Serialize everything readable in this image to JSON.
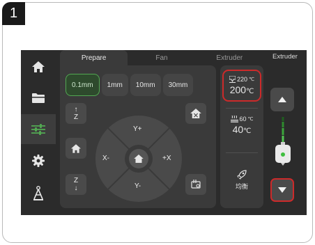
{
  "step_number": "1",
  "tabs": [
    {
      "label": "Prepare",
      "active": true
    },
    {
      "label": "Fan",
      "active": false
    },
    {
      "label": "Extruder",
      "active": false
    }
  ],
  "sidebar": {
    "items": [
      {
        "icon": "home-icon",
        "active": false
      },
      {
        "icon": "folder-icon",
        "active": false
      },
      {
        "icon": "sliders-icon",
        "active": true
      },
      {
        "icon": "gear-icon",
        "active": false
      },
      {
        "icon": "printer-tower-icon",
        "active": false
      }
    ]
  },
  "move": {
    "step_sizes": [
      "0.1mm",
      "1mm",
      "10mm",
      "30mm"
    ],
    "selected_step": "0.1mm",
    "z_up": "Z",
    "z_down": "Z",
    "y_plus": "Y+",
    "y_minus": "Y-",
    "x_minus": "X-",
    "x_plus": "+X"
  },
  "temperatures": {
    "nozzle_target": "220",
    "nozzle_current": "200",
    "bed_target": "60",
    "bed_current": "40",
    "unit": "℃",
    "fan_label": "均衡"
  },
  "extruder": {
    "label": "Extruder"
  },
  "colors": {
    "accent_green": "#52a852",
    "highlight_red": "#cc2a2a",
    "screen_bg": "#2b2b2b",
    "panel_bg": "#3a3a3a"
  }
}
